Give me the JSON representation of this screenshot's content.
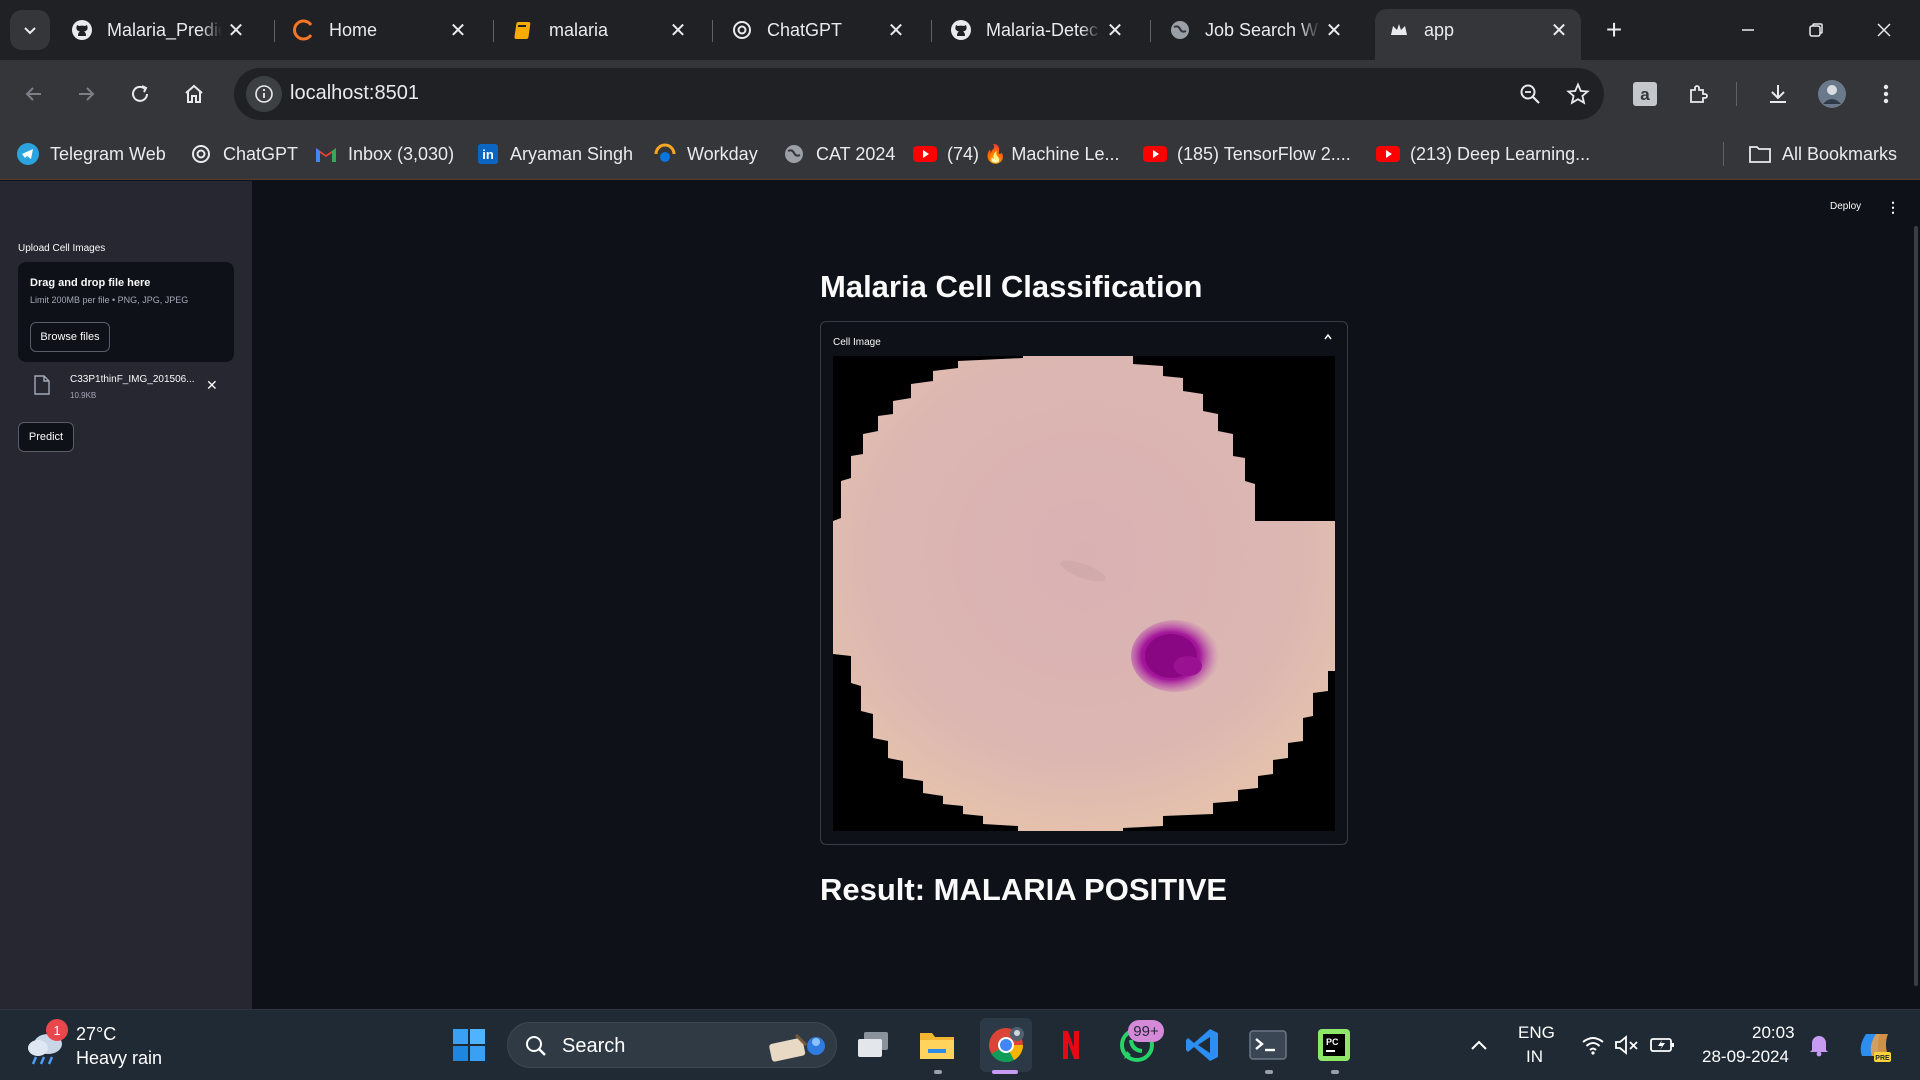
{
  "browser": {
    "tabs": [
      {
        "title": "Malaria_Predic",
        "icon": "github-icon"
      },
      {
        "title": "Home",
        "icon": "orange-ring-icon"
      },
      {
        "title": "malaria",
        "icon": "notebook-icon"
      },
      {
        "title": "ChatGPT",
        "icon": "openai-icon"
      },
      {
        "title": "Malaria-Detec",
        "icon": "github-icon"
      },
      {
        "title": "Job Search W",
        "icon": "globe-icon"
      },
      {
        "title": "app",
        "icon": "streamlit-crown-icon",
        "active": true
      }
    ],
    "url": "localhost:8501",
    "bookmarks": [
      {
        "label": "Telegram Web",
        "icon": "telegram-icon"
      },
      {
        "label": "ChatGPT",
        "icon": "openai-icon"
      },
      {
        "label": "Inbox (3,030)",
        "icon": "gmail-icon"
      },
      {
        "label": "Aryaman Singh",
        "icon": "linkedin-icon"
      },
      {
        "label": "Workday",
        "icon": "workday-icon"
      },
      {
        "label": "CAT 2024",
        "icon": "globe-icon"
      },
      {
        "label": "(74) 🔥 Machine Le...",
        "icon": "youtube-icon"
      },
      {
        "label": "(185) TensorFlow 2....",
        "icon": "youtube-icon"
      },
      {
        "label": "(213) Deep Learning...",
        "icon": "youtube-icon"
      }
    ],
    "all_bookmarks": "All Bookmarks"
  },
  "app": {
    "deploy": "Deploy",
    "sidebar": {
      "upload_label": "Upload Cell Images",
      "dropzone_title": "Drag and drop file here",
      "dropzone_sub": "Limit 200MB per file • PNG, JPG, JPEG",
      "browse": "Browse files",
      "file_name": "C33P1thinF_IMG_201506...",
      "file_size": "10.9KB",
      "predict": "Predict"
    },
    "title": "Malaria Cell Classification",
    "expander_label": "Cell Image",
    "result": "Result: MALARIA POSITIVE"
  },
  "taskbar": {
    "weather_badge": "1",
    "temperature": "27°C",
    "weather": "Heavy rain",
    "search": "Search",
    "whatsapp_badge": "99+",
    "lang_top": "ENG",
    "lang_bottom": "IN",
    "time": "20:03",
    "date": "28-09-2024"
  },
  "colors": {
    "accent_streamlit": "#ff4b4b",
    "app_bg": "#0e1117",
    "sidebar_bg": "#262730",
    "parasite": "#a3169a",
    "cell": "#dcb4b4"
  }
}
